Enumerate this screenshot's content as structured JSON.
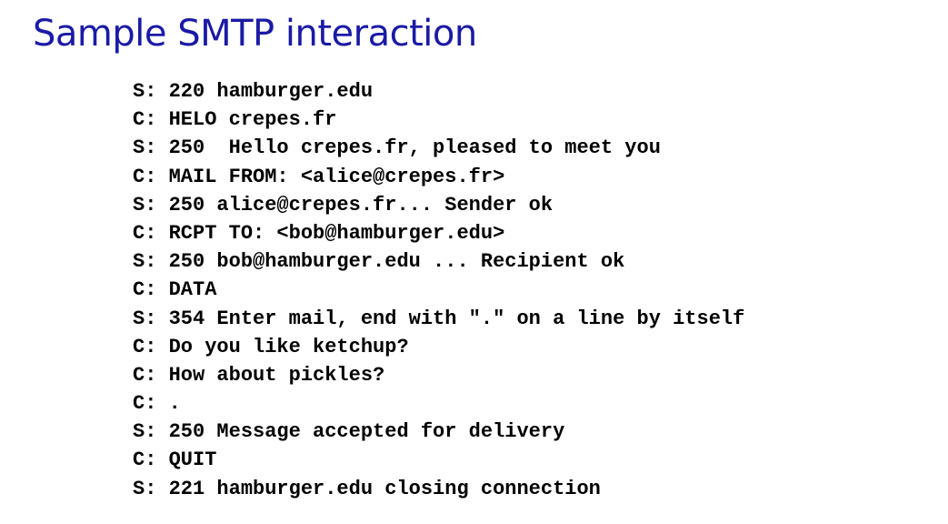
{
  "title": "Sample SMTP interaction",
  "transcript": [
    "S: 220 hamburger.edu",
    "C: HELO crepes.fr",
    "S: 250  Hello crepes.fr, pleased to meet you",
    "C: MAIL FROM: <alice@crepes.fr>",
    "S: 250 alice@crepes.fr... Sender ok",
    "C: RCPT TO: <bob@hamburger.edu>",
    "S: 250 bob@hamburger.edu ... Recipient ok",
    "C: DATA",
    "S: 354 Enter mail, end with \".\" on a line by itself",
    "C: Do you like ketchup?",
    "C: How about pickles?",
    "C: .",
    "S: 250 Message accepted for delivery",
    "C: QUIT",
    "S: 221 hamburger.edu closing connection"
  ]
}
